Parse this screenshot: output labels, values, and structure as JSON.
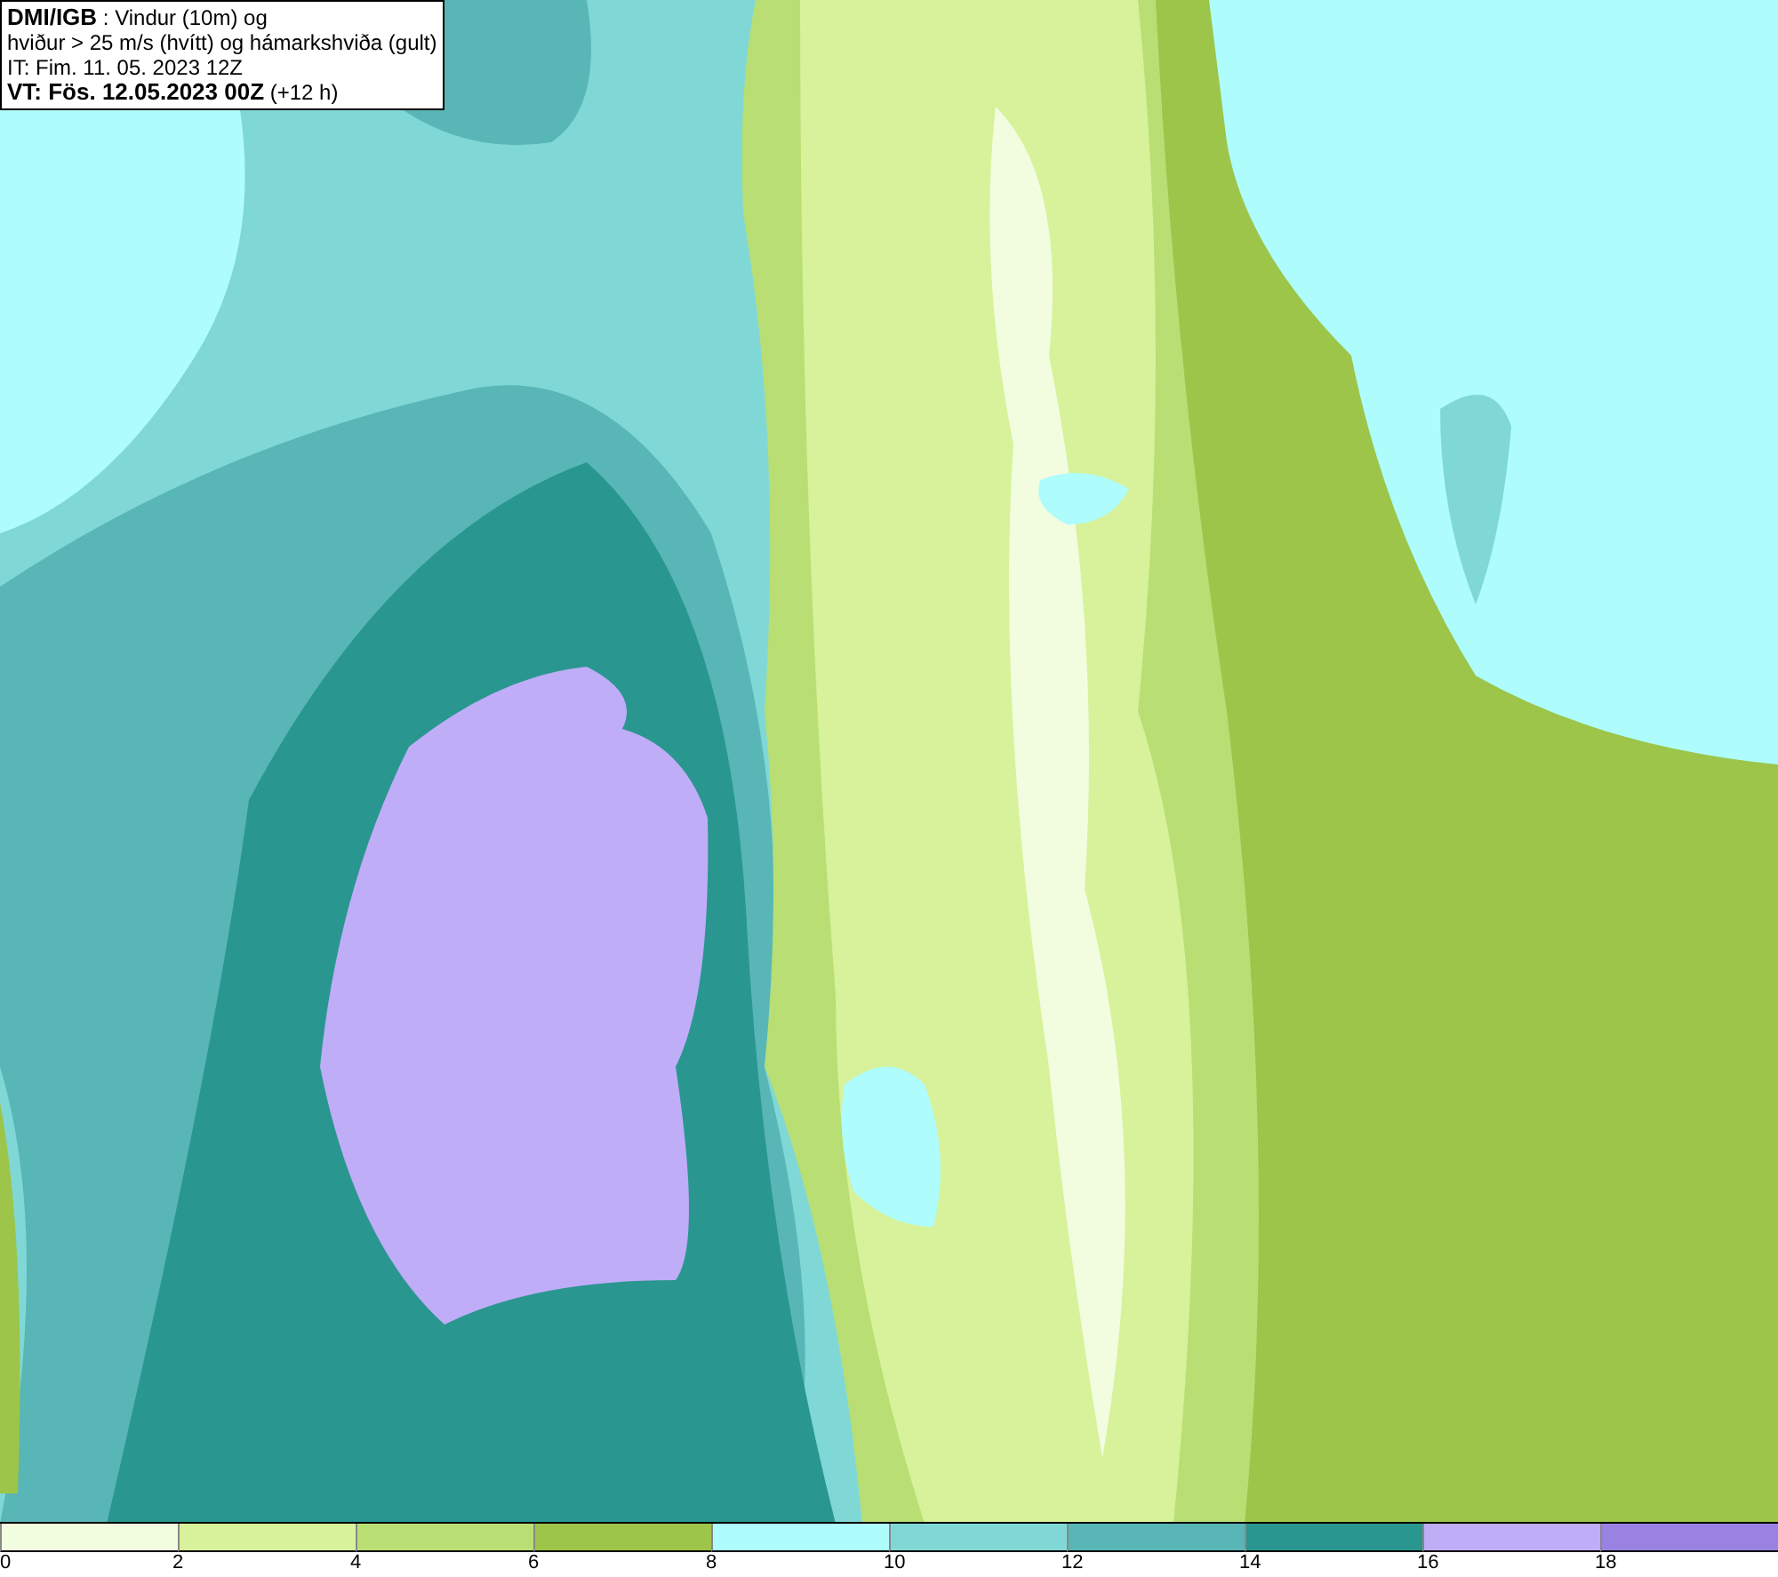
{
  "title_box": {
    "lines": [
      "**DMI/IGB** : Vindur (10m) og",
      "hviður > 25 m/s (hvítt) og hámarkshviða (gult)",
      "IT: Fim. 11. 05. 2023 12Z",
      "**VT: Fös. 12.05.2023 00Z** (+12 h)"
    ]
  },
  "legend": {
    "segments": [
      {
        "label": "0",
        "color": "#f2fde0"
      },
      {
        "label": "2",
        "color": "#d7f29a"
      },
      {
        "label": "4",
        "color": "#b8de74"
      },
      {
        "label": "6",
        "color": "#9cc54a"
      },
      {
        "label": "8",
        "color": "#aefcfc"
      },
      {
        "label": "10",
        "color": "#80d8d6"
      },
      {
        "label": "12",
        "color": "#58b6b6"
      },
      {
        "label": "14",
        "color": "#2a9690"
      },
      {
        "label": "16",
        "color": "#bfadf7"
      },
      {
        "label": "18",
        "color": "#9a82e2"
      }
    ]
  }
}
